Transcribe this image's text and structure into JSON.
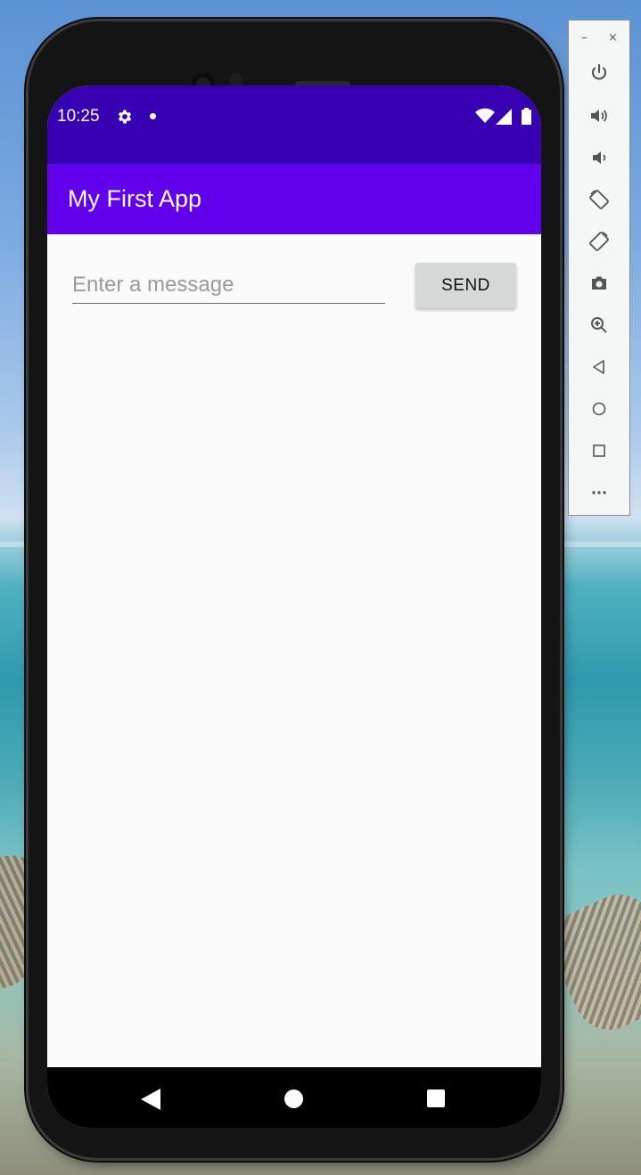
{
  "status_bar": {
    "time": "10:25",
    "icons": [
      "gear-icon",
      "notification-dot",
      "wifi-icon",
      "cell-signal-icon",
      "battery-icon"
    ],
    "color": "#3700b3"
  },
  "app_bar": {
    "title": "My First App",
    "color": "#6200ee"
  },
  "main": {
    "message_input": {
      "value": "",
      "placeholder": "Enter a message"
    },
    "send_button": {
      "label": "SEND"
    }
  },
  "nav_bar": {
    "buttons": [
      "back",
      "home",
      "recents"
    ]
  },
  "emulator_toolbar": {
    "window_controls": [
      "minimize",
      "close"
    ],
    "tools": [
      "power",
      "volume-up",
      "volume-down",
      "rotate-left",
      "rotate-right",
      "screenshot",
      "zoom",
      "back",
      "home",
      "overview",
      "more"
    ]
  }
}
